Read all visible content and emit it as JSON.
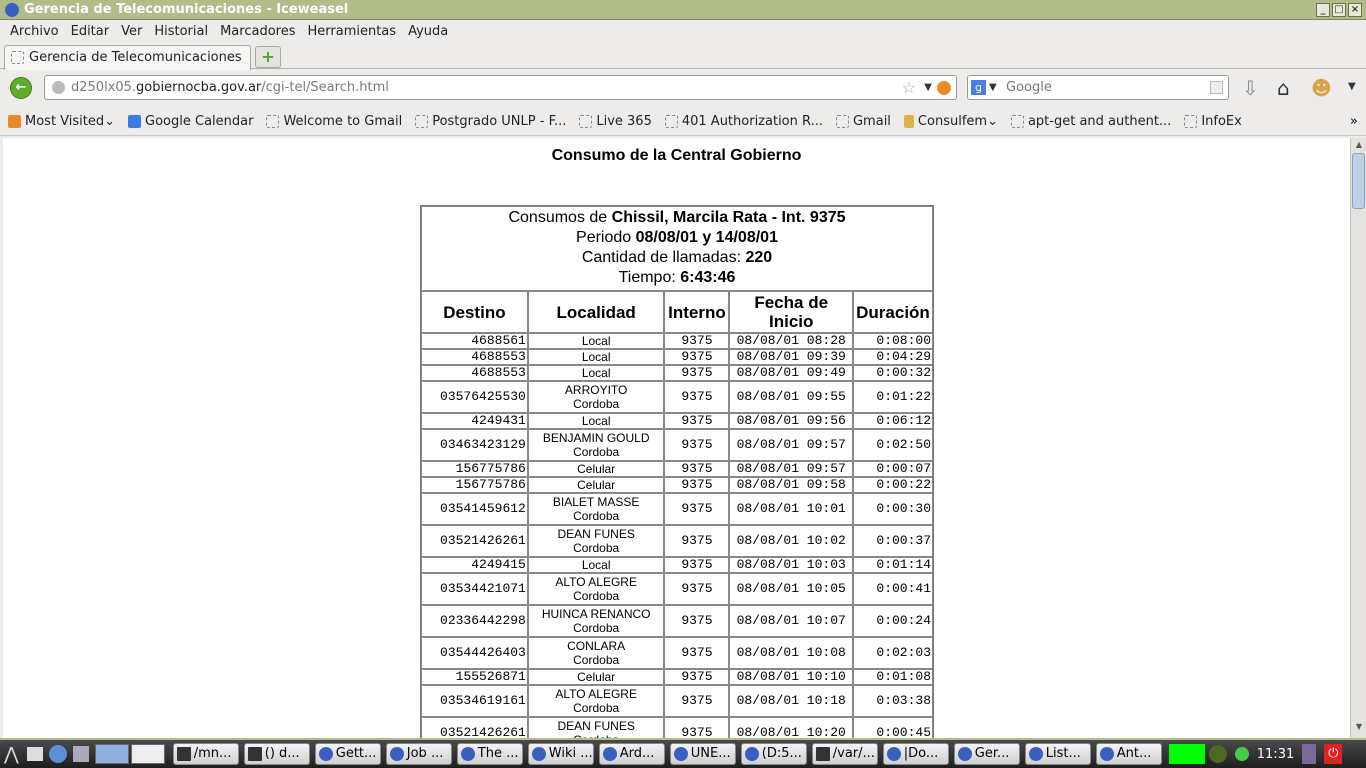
{
  "window": {
    "title": "Gerencia de Telecomunicaciones - Iceweasel"
  },
  "menu": [
    "Archivo",
    "Editar",
    "Ver",
    "Historial",
    "Marcadores",
    "Herramientas",
    "Ayuda"
  ],
  "tab": {
    "label": "Gerencia de Telecomunicaciones"
  },
  "url": {
    "pre": "d250lx05.",
    "domain": "gobiernocba.gov.ar",
    "path": "/cgi-tel/Search.html"
  },
  "search": {
    "placeholder": "Google"
  },
  "bookmarks": [
    "Most Visited",
    "Google Calendar",
    "Welcome to Gmail",
    "Postgrado UNLP - F...",
    "Live 365",
    "401 Authorization R...",
    "Gmail",
    "Consulfem",
    "apt-get and authent...",
    "InfoEx"
  ],
  "page": {
    "title": "Consumo de la Central Gobierno",
    "summary": {
      "consumos_label": "Consumos de ",
      "person": "Chissil, Marcila Rata - Int. 9375",
      "periodo_label": "Periodo ",
      "periodo": "08/08/01 y 14/08/01",
      "cantidad_label": "Cantidad de llamadas: ",
      "cantidad": "220",
      "tiempo_label": "Tiempo: ",
      "tiempo": "6:43:46"
    },
    "columns": [
      "Destino",
      "Localidad",
      "Interno",
      "Fecha de Inicio",
      "Duración"
    ],
    "rows": [
      [
        "4688561",
        "Local",
        "",
        "9375",
        "08/08/01 08:28",
        "0:08:00"
      ],
      [
        "4688553",
        "Local",
        "",
        "9375",
        "08/08/01 09:39",
        "0:04:29"
      ],
      [
        "4688553",
        "Local",
        "",
        "9375",
        "08/08/01 09:49",
        "0:00:32"
      ],
      [
        "03576425530",
        "ARROYITO",
        "Cordoba",
        "9375",
        "08/08/01 09:55",
        "0:01:22"
      ],
      [
        "4249431",
        "Local",
        "",
        "9375",
        "08/08/01 09:56",
        "0:06:12"
      ],
      [
        "03463423129",
        "BENJAMIN GOULD",
        "Cordoba",
        "9375",
        "08/08/01 09:57",
        "0:02:50"
      ],
      [
        "156775786",
        "Celular",
        "",
        "9375",
        "08/08/01 09:57",
        "0:00:07"
      ],
      [
        "156775786",
        "Celular",
        "",
        "9375",
        "08/08/01 09:58",
        "0:00:22"
      ],
      [
        "03541459612",
        "BIALET MASSE",
        "Cordoba",
        "9375",
        "08/08/01 10:01",
        "0:00:30"
      ],
      [
        "03521426261",
        "DEAN FUNES",
        "Cordoba",
        "9375",
        "08/08/01 10:02",
        "0:00:37"
      ],
      [
        "4249415",
        "Local",
        "",
        "9375",
        "08/08/01 10:03",
        "0:01:14"
      ],
      [
        "03534421071",
        "ALTO ALEGRE",
        "Cordoba",
        "9375",
        "08/08/01 10:05",
        "0:00:41"
      ],
      [
        "02336442298",
        "HUINCA RENANCO",
        "Cordoba",
        "9375",
        "08/08/01 10:07",
        "0:00:24"
      ],
      [
        "03544426403",
        "CONLARA",
        "Cordoba",
        "9375",
        "08/08/01 10:08",
        "0:02:03"
      ],
      [
        "155526871",
        "Celular",
        "",
        "9375",
        "08/08/01 10:10",
        "0:01:08"
      ],
      [
        "03534619161",
        "ALTO ALEGRE",
        "Cordoba",
        "9375",
        "08/08/01 10:18",
        "0:03:38"
      ],
      [
        "03521426261",
        "DEAN FUNES",
        "Cordoba",
        "9375",
        "08/08/01 10:20",
        "0:00:45"
      ]
    ]
  },
  "taskbar": {
    "items": [
      {
        "label": "/mn...",
        "icon": "terminal"
      },
      {
        "label": "() d...",
        "icon": "terminal"
      },
      {
        "label": "Gett...",
        "icon": "browser"
      },
      {
        "label": "Job ...",
        "icon": "browser"
      },
      {
        "label": "The ...",
        "icon": "browser"
      },
      {
        "label": "Wiki ...",
        "icon": "browser"
      },
      {
        "label": "Ard...",
        "icon": "browser"
      },
      {
        "label": "UNE...",
        "icon": "browser"
      },
      {
        "label": "(D:5...",
        "icon": "browser"
      },
      {
        "label": "/var/...",
        "icon": "terminal"
      },
      {
        "label": "|Do...",
        "icon": "jdownloader"
      },
      {
        "label": "Ger...",
        "icon": "browser"
      },
      {
        "label": "List...",
        "icon": "wizard"
      },
      {
        "label": "Ant...",
        "icon": "clock"
      }
    ],
    "clock": "11:31"
  }
}
